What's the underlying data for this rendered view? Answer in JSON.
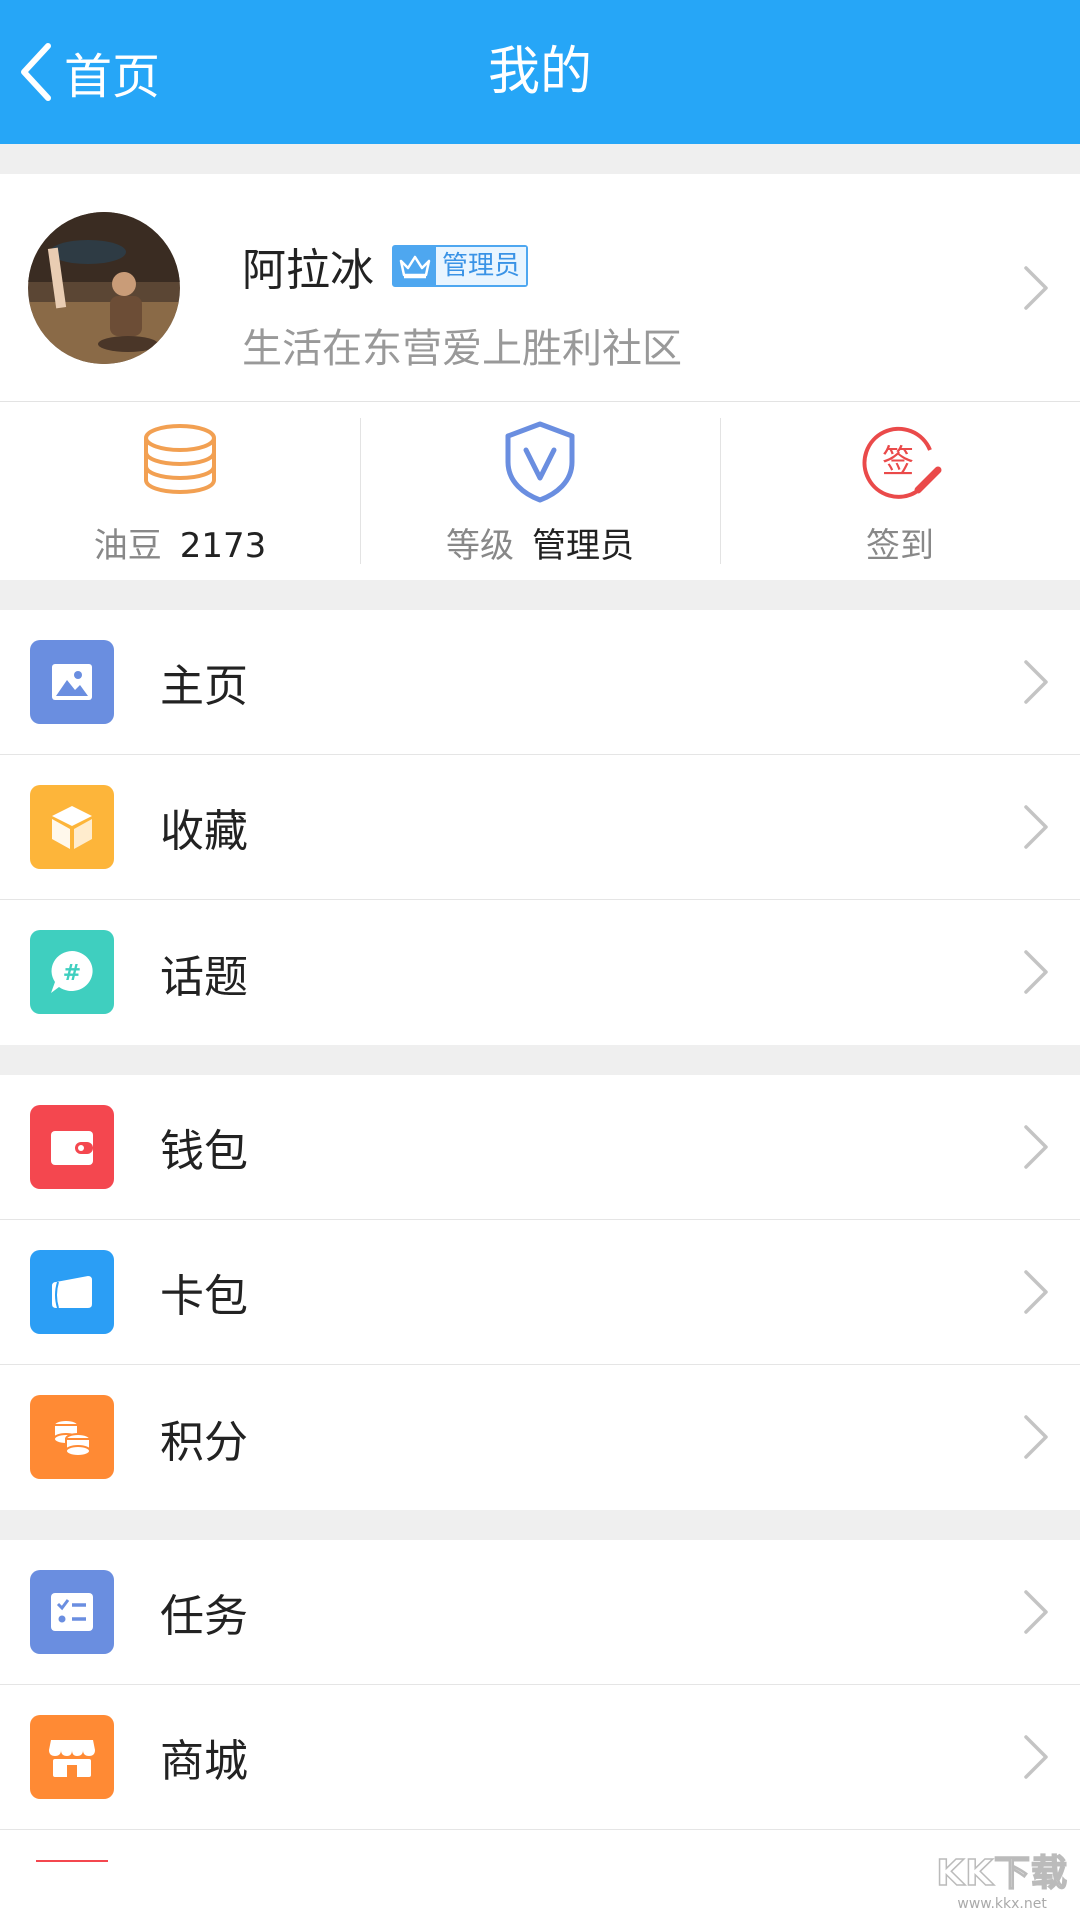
{
  "header": {
    "back_label": "首页",
    "title": "我的",
    "bg_color": "#26a6f7"
  },
  "profile": {
    "name": "阿拉冰",
    "badge": "管理员",
    "signature": "生活在东营爱上胜利社区"
  },
  "stats": [
    {
      "icon": "coins-stack-icon",
      "label": "油豆",
      "value": "2173"
    },
    {
      "icon": "shield-v-icon",
      "label": "等级",
      "value": "管理员"
    },
    {
      "icon": "sign-in-stamp-icon",
      "label": "签到",
      "stamp_char": "签"
    }
  ],
  "menu_groups": [
    [
      {
        "label": "主页",
        "icon": "image-icon",
        "color": "#6a8ee0"
      },
      {
        "label": "收藏",
        "icon": "box-icon",
        "color": "#fdb53a"
      },
      {
        "label": "话题",
        "icon": "hashtag-chat-icon",
        "color": "#3fcfbf",
        "hash": "#"
      }
    ],
    [
      {
        "label": "钱包",
        "icon": "wallet-icon",
        "color": "#f4474f"
      },
      {
        "label": "卡包",
        "icon": "card-icon",
        "color": "#2b9ef5"
      },
      {
        "label": "积分",
        "icon": "coins-icon",
        "color": "#ff8a34"
      }
    ],
    [
      {
        "label": "任务",
        "icon": "checklist-icon",
        "color": "#6a8ee0"
      },
      {
        "label": "商城",
        "icon": "store-icon",
        "color": "#ff8a34"
      }
    ]
  ],
  "watermark": {
    "logo": "KK下载",
    "url": "www.kkx.net"
  }
}
